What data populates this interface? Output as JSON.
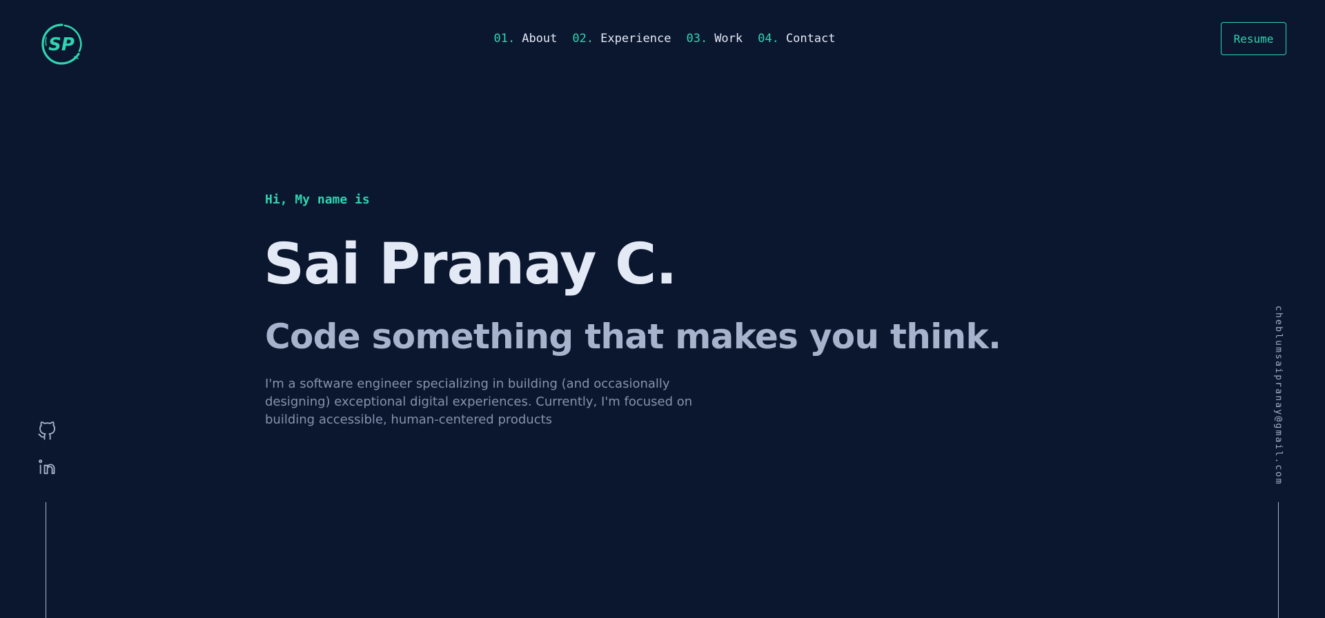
{
  "header": {
    "logo_text": "SP",
    "nav": [
      {
        "num": "01.",
        "label": "About"
      },
      {
        "num": "02.",
        "label": "Experience"
      },
      {
        "num": "03.",
        "label": "Work"
      },
      {
        "num": "04.",
        "label": "Contact"
      }
    ],
    "resume_label": "Resume"
  },
  "hero": {
    "greeting": "Hi, My name is",
    "name": "Sai Pranay C.",
    "tagline": "Code something that makes you think.",
    "bio": "I'm a software engineer specializing in building (and occasionally designing) exceptional digital experiences. Currently, I'm focused on building accessible, human-centered products"
  },
  "social": {
    "icons": [
      "github-icon",
      "linkedin-icon"
    ]
  },
  "email": "cheblumsaipranay@gmail.com",
  "colors": {
    "background": "#0b172f",
    "accent": "#2fd5b0",
    "heading": "#e4e9f6",
    "subheading": "#a7b2cd",
    "body": "#8792ad"
  }
}
